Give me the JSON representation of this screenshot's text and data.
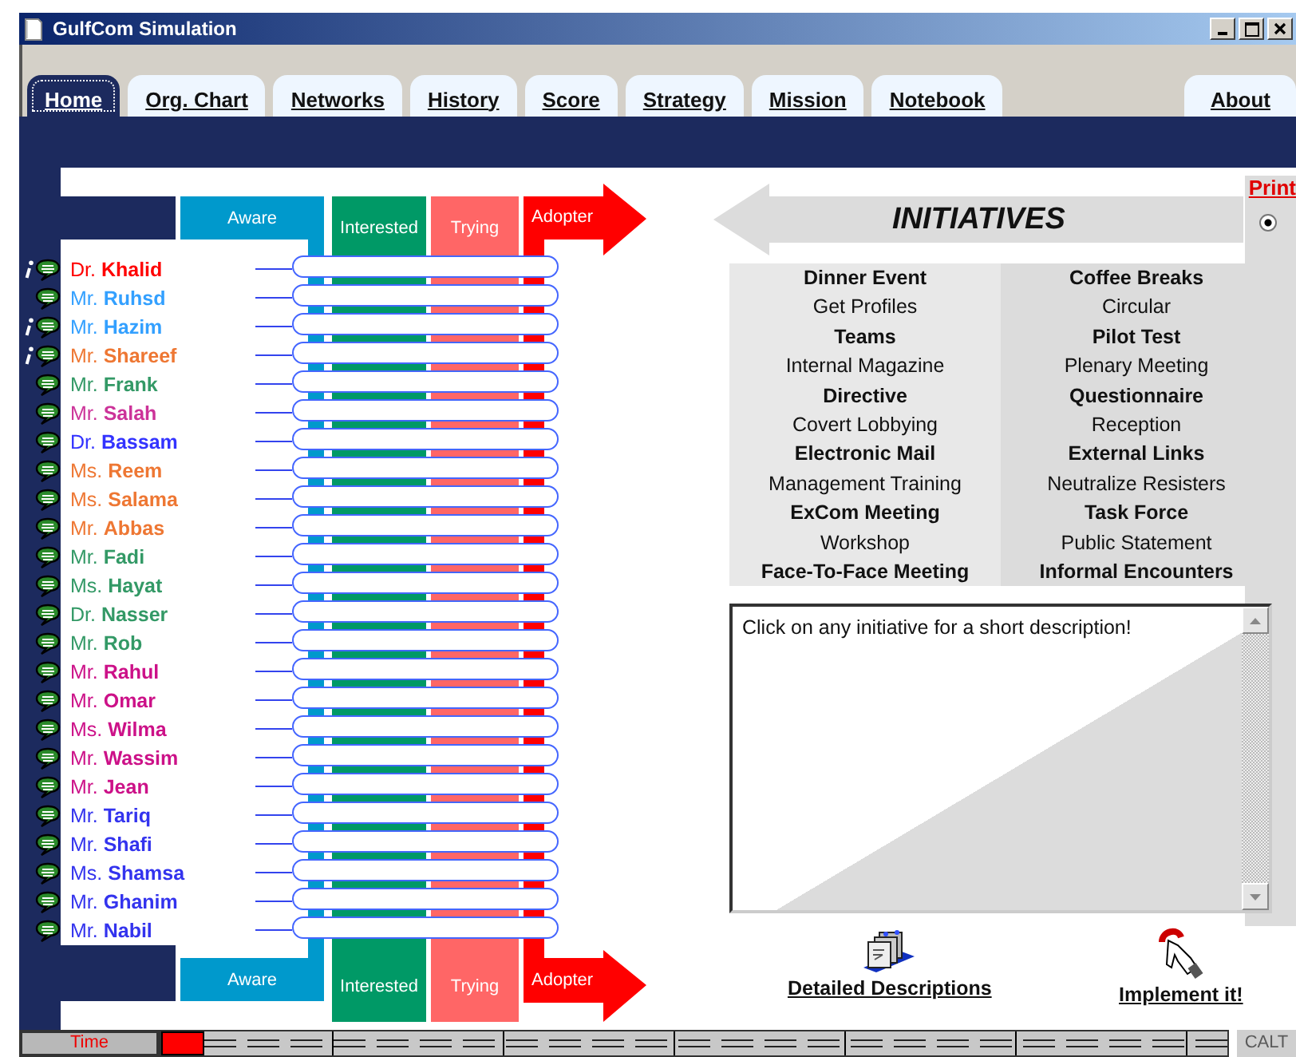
{
  "window": {
    "title": "GulfCom Simulation"
  },
  "tabs": [
    {
      "label": "Home",
      "selected": true
    },
    {
      "label": "Org. Chart",
      "selected": false
    },
    {
      "label": "Networks",
      "selected": false
    },
    {
      "label": "History",
      "selected": false
    },
    {
      "label": "Score",
      "selected": false
    },
    {
      "label": "Strategy",
      "selected": false
    },
    {
      "label": "Mission",
      "selected": false
    },
    {
      "label": "Notebook",
      "selected": false
    },
    {
      "label": "About",
      "selected": false
    }
  ],
  "stages_top": [
    {
      "label": "Aware",
      "color": "#0099cc",
      "kind": "box"
    },
    {
      "label": "Interested",
      "color": "#009966",
      "kind": "box"
    },
    {
      "label": "Trying",
      "color": "#ff6666",
      "kind": "box"
    },
    {
      "label": "Adopter",
      "color": "#ff0000",
      "kind": "arrow"
    }
  ],
  "people": [
    {
      "name": "Dr. **Khalid**",
      "color": "#ff0000",
      "info": true
    },
    {
      "name": "Mr. **Ruhsd**",
      "color": "#33a0ff",
      "info": false
    },
    {
      "name": "Mr. **Hazim**",
      "color": "#33a0ff",
      "info": true
    },
    {
      "name": "Mr. **Shareef**",
      "color": "#ee7733",
      "info": true
    },
    {
      "name": "Mr. **Frank**",
      "color": "#339966",
      "info": false
    },
    {
      "name": "Mr. **Salah**",
      "color": "#cc3399",
      "info": false
    },
    {
      "name": "Dr. **Bassam**",
      "color": "#3333ff",
      "info": false
    },
    {
      "name": "Ms. **Reem**",
      "color": "#ee7733",
      "info": false
    },
    {
      "name": "Ms. **Salama**",
      "color": "#ee7733",
      "info": false
    },
    {
      "name": "Mr. **Abbas**",
      "color": "#ee7733",
      "info": false
    },
    {
      "name": "Mr. **Fadi**",
      "color": "#339966",
      "info": false
    },
    {
      "name": "Ms. **Hayat**",
      "color": "#339966",
      "info": false
    },
    {
      "name": "Dr. **Nasser**",
      "color": "#339966",
      "info": false
    },
    {
      "name": "Mr. **Rob**",
      "color": "#339966",
      "info": false
    },
    {
      "name": "Mr. **Rahul**",
      "color": "#cc1188",
      "info": false
    },
    {
      "name": "Mr. **Omar**",
      "color": "#cc1188",
      "info": false
    },
    {
      "name": "Ms. **Wilma**",
      "color": "#cc1188",
      "info": false
    },
    {
      "name": "Mr. **Wassim**",
      "color": "#cc1188",
      "info": false
    },
    {
      "name": "Mr. **Jean**",
      "color": "#cc1188",
      "info": false
    },
    {
      "name": "Mr. **Tariq**",
      "color": "#3333ee",
      "info": false
    },
    {
      "name": "Mr. **Shafi**",
      "color": "#3333ee",
      "info": false
    },
    {
      "name": "Ms. **Shamsa**",
      "color": "#3333ee",
      "info": false
    },
    {
      "name": "Mr. **Ghanim**",
      "color": "#3333ee",
      "info": false
    },
    {
      "name": "Mr. **Nabil**",
      "color": "#3333ee",
      "info": false
    }
  ],
  "stages_bottom": [
    {
      "label": "Aware",
      "color": "#0099cc",
      "kind": "box"
    },
    {
      "label": "Interested",
      "color": "#009966",
      "kind": "box"
    },
    {
      "label": "Trying",
      "color": "#ff6666",
      "kind": "box"
    },
    {
      "label": "Adopter",
      "color": "#ff0000",
      "kind": "arrow"
    }
  ],
  "initiatives": {
    "title": "INITIATIVES",
    "print_link": "Print",
    "radio_selected": true,
    "columns": [
      [
        {
          "label": "Dinner Event",
          "bold": true
        },
        {
          "label": "Get Profiles",
          "bold": false
        },
        {
          "label": "Teams",
          "bold": true
        },
        {
          "label": "Internal Magazine",
          "bold": false
        },
        {
          "label": "Directive",
          "bold": true
        },
        {
          "label": "Covert Lobbying",
          "bold": false
        },
        {
          "label": "Electronic Mail",
          "bold": true
        },
        {
          "label": "Management Training",
          "bold": false
        },
        {
          "label": "ExCom Meeting",
          "bold": true
        },
        {
          "label": "Workshop",
          "bold": false
        },
        {
          "label": "Face-To-Face Meeting",
          "bold": true
        }
      ],
      [
        {
          "label": "Coffee Breaks",
          "bold": true
        },
        {
          "label": "Circular",
          "bold": false
        },
        {
          "label": "Pilot Test",
          "bold": true
        },
        {
          "label": "Plenary Meeting",
          "bold": false
        },
        {
          "label": "Questionnaire",
          "bold": true
        },
        {
          "label": "Reception",
          "bold": false
        },
        {
          "label": "External Links",
          "bold": true
        },
        {
          "label": "Neutralize Resisters",
          "bold": false
        },
        {
          "label": "Task Force",
          "bold": true
        },
        {
          "label": "Public Statement",
          "bold": false
        },
        {
          "label": "Informal Encounters",
          "bold": true
        }
      ]
    ]
  },
  "description": {
    "text": "Click on any initiative for a short description!"
  },
  "actions": [
    {
      "label": "Detailed Descriptions",
      "kind": "descriptions"
    },
    {
      "label": "Implement it!",
      "kind": "implement"
    }
  ],
  "status_bar": {
    "time_label": "Time",
    "level": 0.04,
    "mode": "CALT"
  }
}
